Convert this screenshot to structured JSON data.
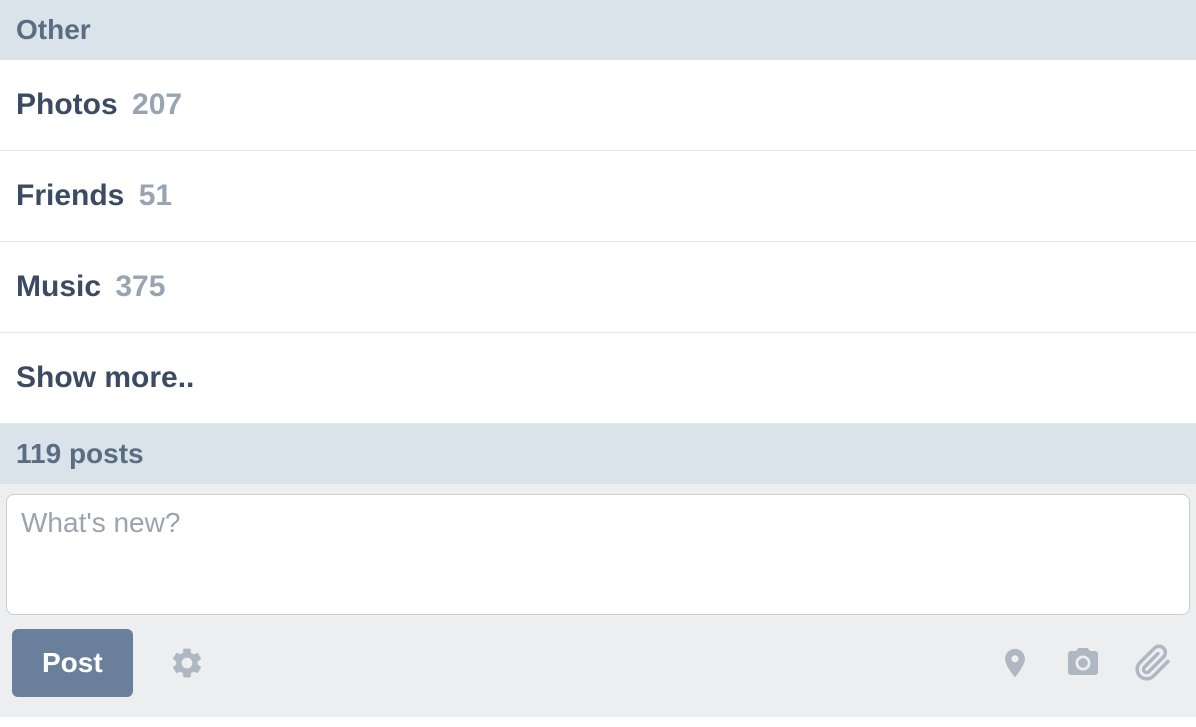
{
  "section_header": "Other",
  "menu": {
    "photos": {
      "label": "Photos",
      "count": "207"
    },
    "friends": {
      "label": "Friends",
      "count": "51"
    },
    "music": {
      "label": "Music",
      "count": "375"
    },
    "show_more": "Show more.."
  },
  "posts_header": "119 posts",
  "compose": {
    "placeholder": "What's new?",
    "post_button": "Post"
  }
}
